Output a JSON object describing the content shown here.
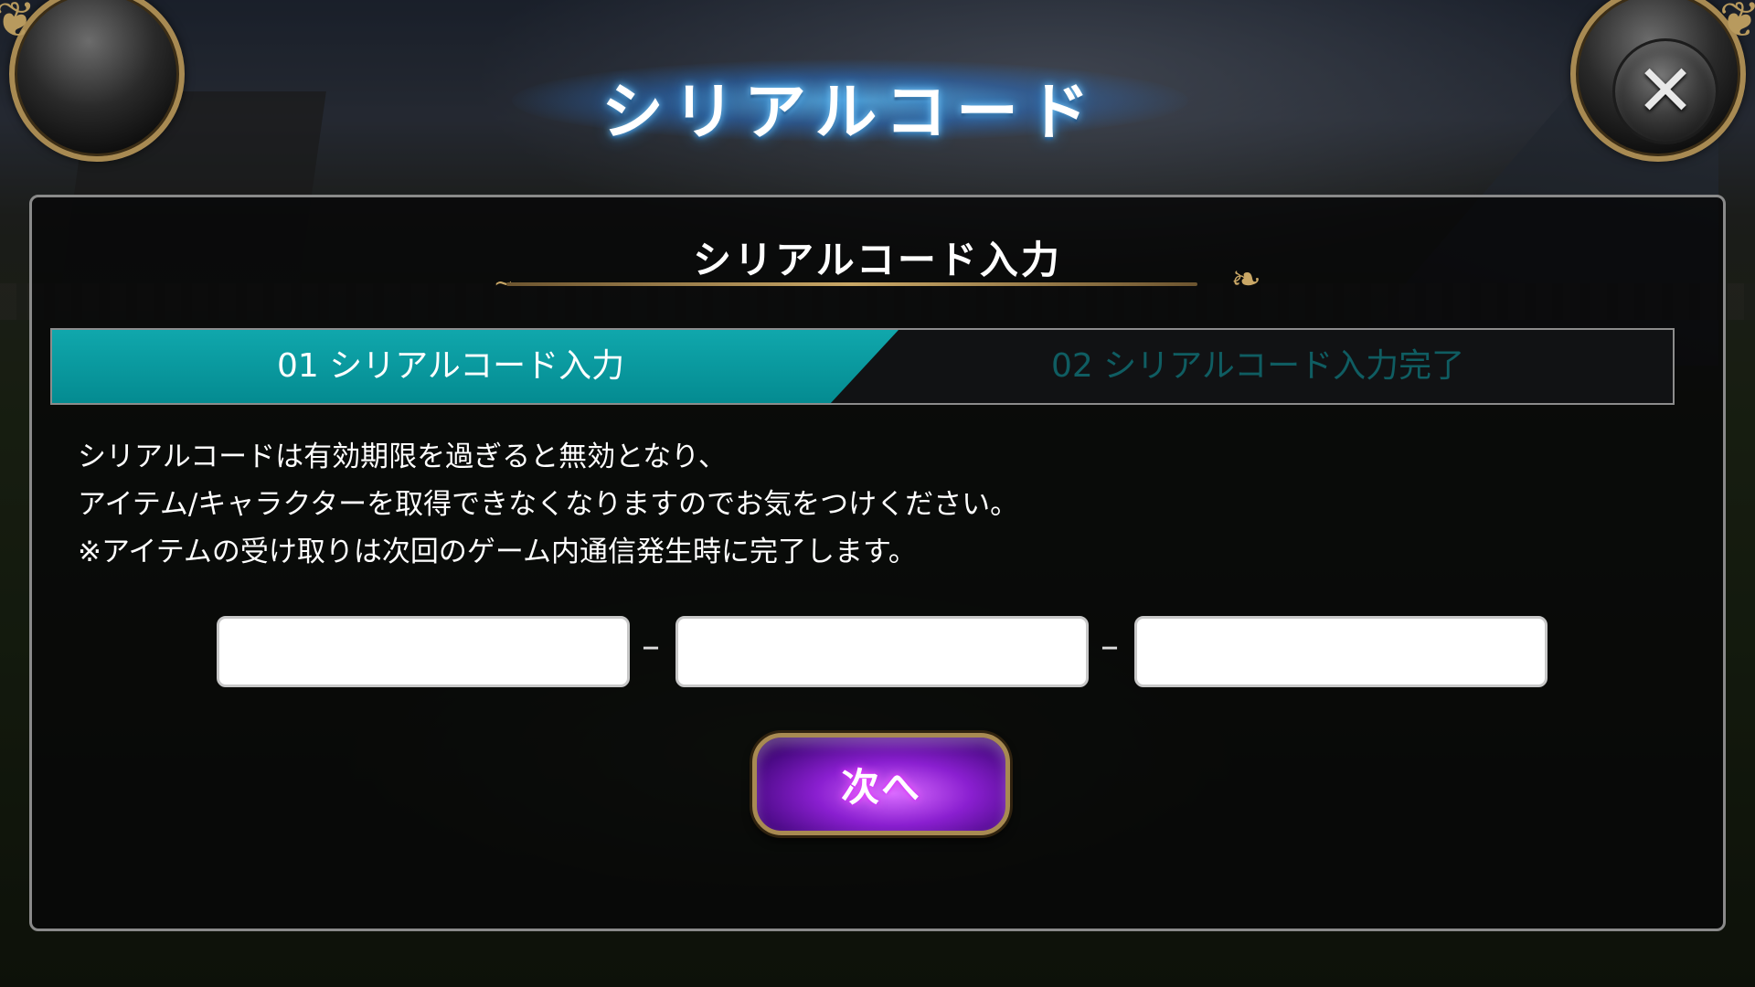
{
  "header": {
    "title": "シリアルコード",
    "close_icon": "close-icon"
  },
  "panel": {
    "heading": "シリアルコード入力",
    "steps": [
      {
        "label": "01 シリアルコード入力",
        "active": true
      },
      {
        "label": "02 シリアルコード入力完了",
        "active": false
      }
    ],
    "description": [
      "シリアルコードは有効期限を過ぎると無効となり、",
      "アイテム/キャラクターを取得できなくなりますのでお気をつけください。",
      "※アイテムの受け取りは次回のゲーム内通信発生時に完了します。"
    ],
    "code_fields": [
      {
        "value": "",
        "placeholder": ""
      },
      {
        "value": "",
        "placeholder": ""
      },
      {
        "value": "",
        "placeholder": ""
      }
    ],
    "separator": "–",
    "next_button_label": "次へ"
  },
  "colors": {
    "step_active": "#09999f",
    "step_inactive_text": "#0f5d62",
    "next_button": "#8a1fd0",
    "frame_gold": "#a88a52",
    "title_glow": "#2f8fe0"
  }
}
